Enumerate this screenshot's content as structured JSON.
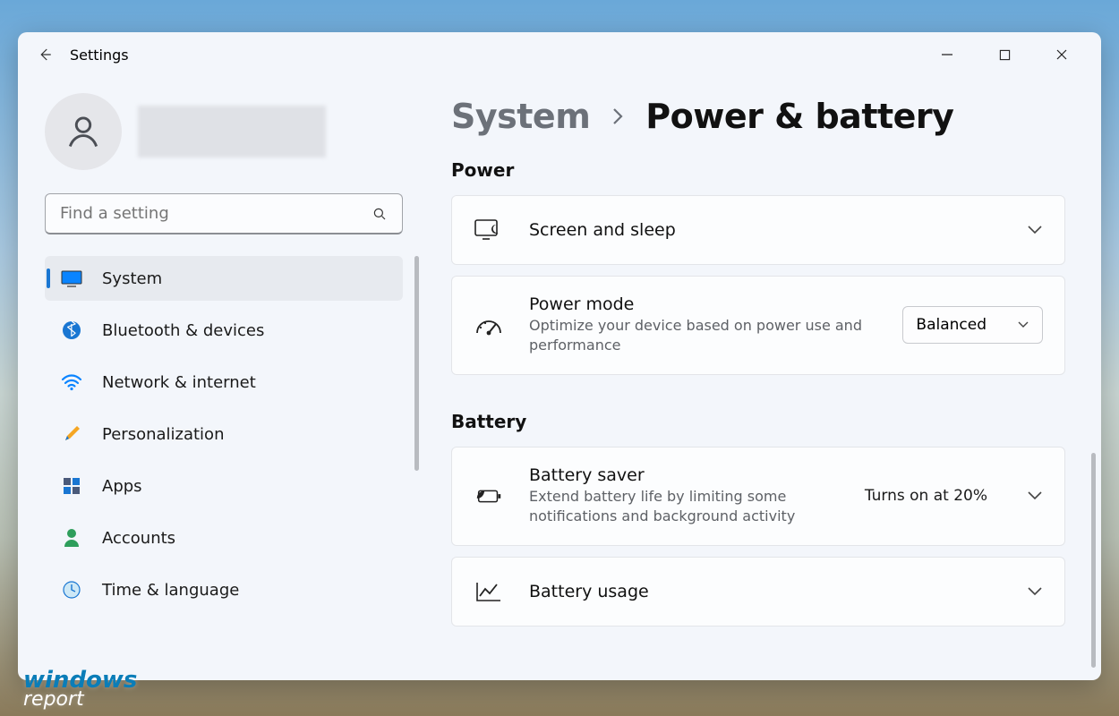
{
  "header": {
    "title": "Settings"
  },
  "search": {
    "placeholder": "Find a setting"
  },
  "sidebar": {
    "items": [
      {
        "label": "System"
      },
      {
        "label": "Bluetooth & devices"
      },
      {
        "label": "Network & internet"
      },
      {
        "label": "Personalization"
      },
      {
        "label": "Apps"
      },
      {
        "label": "Accounts"
      },
      {
        "label": "Time & language"
      }
    ]
  },
  "breadcrumb": {
    "parent": "System",
    "current": "Power & battery"
  },
  "sections": {
    "power": {
      "title": "Power",
      "screen_sleep": {
        "title": "Screen and sleep"
      },
      "power_mode": {
        "title": "Power mode",
        "subtitle": "Optimize your device based on power use and performance",
        "value": "Balanced"
      }
    },
    "battery": {
      "title": "Battery",
      "saver": {
        "title": "Battery saver",
        "subtitle": "Extend battery life by limiting some notifications and background activity",
        "value": "Turns on at 20%"
      },
      "usage": {
        "title": "Battery usage"
      }
    }
  },
  "watermark": {
    "line1": "windows",
    "line2": "report"
  }
}
